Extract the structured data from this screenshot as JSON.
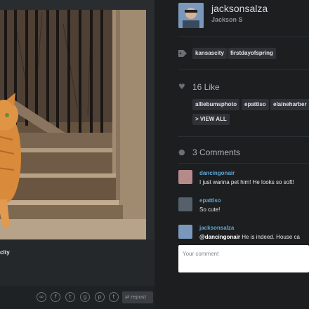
{
  "post": {
    "caption": "city"
  },
  "share": {
    "icons": [
      "link-icon",
      "facebook-icon",
      "twitter-icon",
      "google-plus-icon",
      "pinterest-icon",
      "tumblr-icon"
    ],
    "icon_glyphs": [
      "∞",
      "f",
      "t",
      "g",
      "p",
      "t"
    ],
    "repost_label": "repost"
  },
  "author": {
    "username": "jacksonsalza",
    "real_name": "Jackson S"
  },
  "tags": [
    "kansascity",
    "firstdayofspring"
  ],
  "likes": {
    "title": "16 Like",
    "users": [
      "alliebumsphoto",
      "epattiso",
      "elaineharber"
    ],
    "view_all": "> VIEW ALL"
  },
  "comments": {
    "title": "3 Comments",
    "items": [
      {
        "user": "dancingonair",
        "text": "I just wanna pet him! He looks so soft!",
        "mention": ""
      },
      {
        "user": "epattiso",
        "text": "So cute!",
        "mention": ""
      },
      {
        "user": "jacksonsalza",
        "mention": "@dancingonair",
        "text": "He is indeed. House ca"
      }
    ],
    "placeholder": "Your comment"
  },
  "colors": {
    "accent_link": "#5fa7d6",
    "background": "#1c1e20",
    "tag_bg": "#2e3236"
  }
}
